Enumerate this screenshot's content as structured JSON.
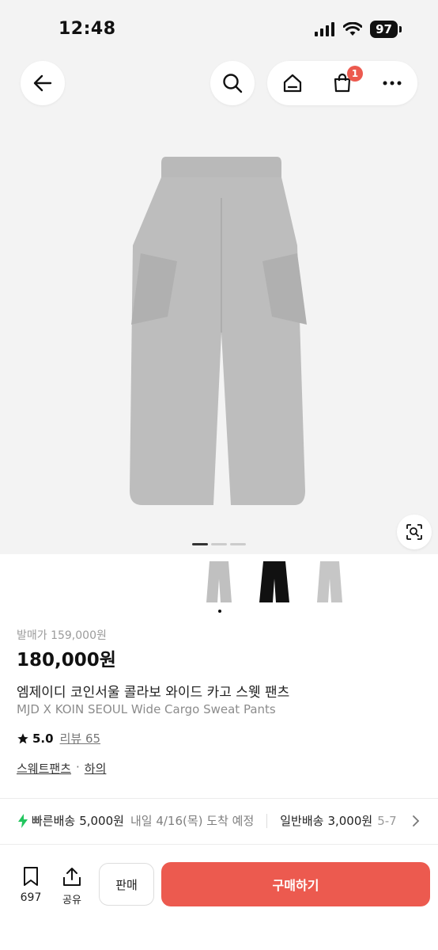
{
  "status_bar": {
    "time": "12:48",
    "battery": "97"
  },
  "nav": {
    "cart_count": "1"
  },
  "gallery": {
    "image_count": 3,
    "active_index": 0,
    "thumbnail_colors": [
      "gray",
      "black",
      "gray"
    ]
  },
  "product": {
    "original_price": "발매가 159,000원",
    "price": "180,000원",
    "title_ko": "엠제이디 코인서울 콜라보 와이드 카고 스웻 팬츠",
    "title_en": "MJD X KOIN SEOUL Wide Cargo Sweat Pants",
    "rating": "5.0",
    "reviews": "리뷰 65",
    "category_1": "스웨트팬츠",
    "category_sep": "·",
    "category_2": "하의"
  },
  "shipping": {
    "fast_label": "빠른배송",
    "fast_price": "5,000원",
    "fast_eta": "내일 4/16(목) 도착 예정",
    "normal_label": "일반배송",
    "normal_price": "3,000원",
    "normal_eta": "5-7"
  },
  "bottom_bar": {
    "bookmark_count": "697",
    "share_label": "공유",
    "sell_label": "판매",
    "buy_label": "구매하기"
  },
  "colors": {
    "accent": "#ec5a4f",
    "fast_icon": "#22c55e",
    "image_bg": "#f3f3f3"
  },
  "icons": [
    "back-arrow-icon",
    "search-icon",
    "home-icon",
    "cart-icon",
    "more-icon",
    "lens-icon",
    "bolt-icon",
    "chevron-right-icon",
    "bookmark-icon",
    "share-icon",
    "star-icon"
  ]
}
